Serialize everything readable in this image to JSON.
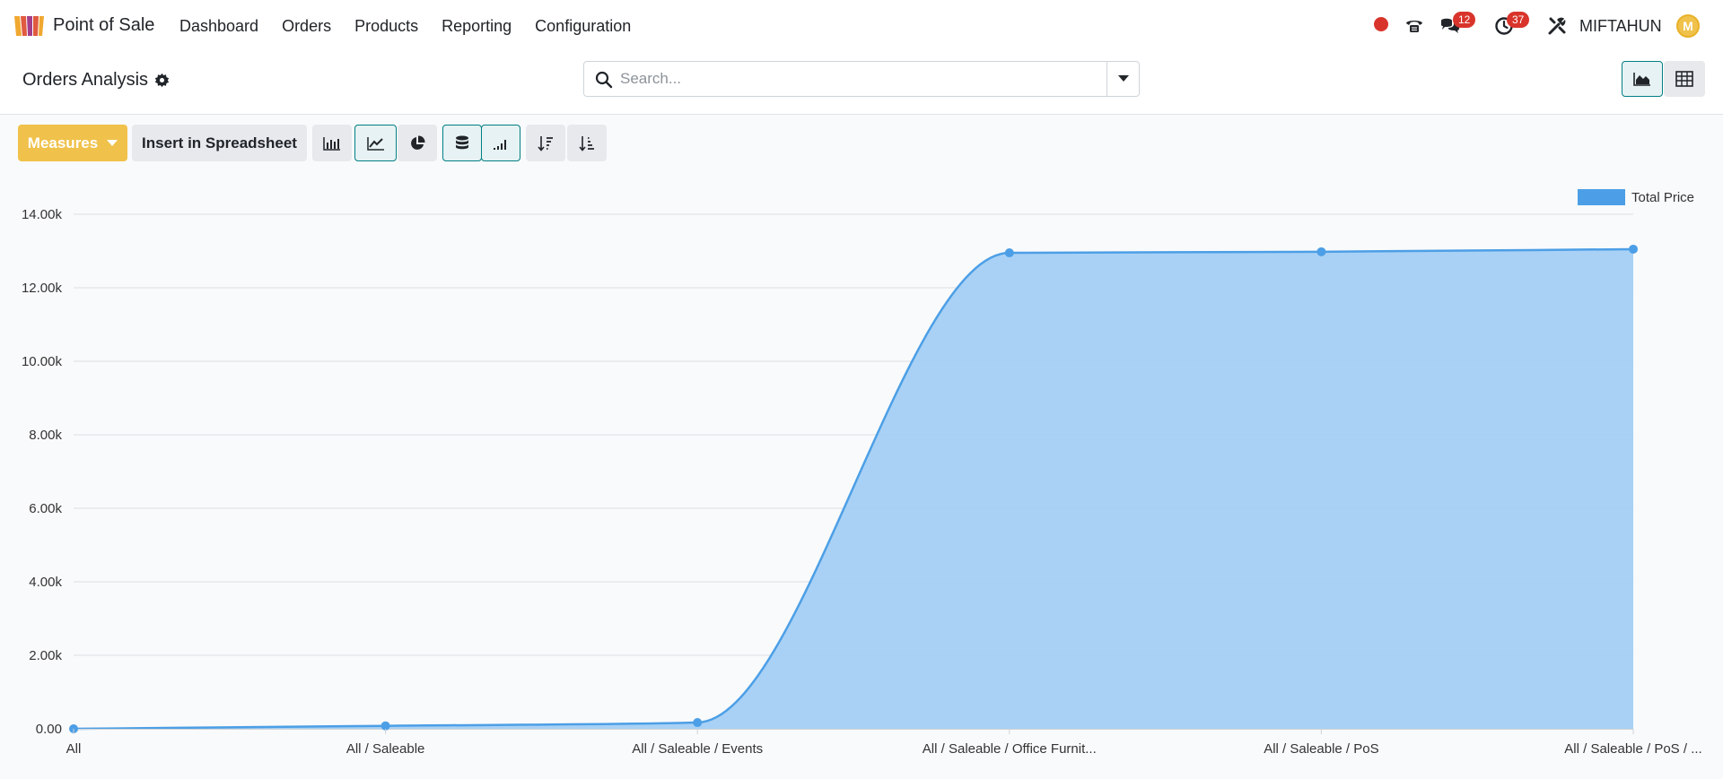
{
  "navbar": {
    "app_title": "Point of Sale",
    "menu": [
      "Dashboard",
      "Orders",
      "Products",
      "Reporting",
      "Configuration"
    ],
    "messages_count": "12",
    "activities_count": "37",
    "user_name": "MIFTAHUN",
    "avatar_letter": "M"
  },
  "control_panel": {
    "breadcrumb": "Orders Analysis",
    "search_placeholder": "Search..."
  },
  "toolbar": {
    "measures_label": "Measures",
    "insert_label": "Insert in Spreadsheet"
  },
  "colors": {
    "accent": "#017e84",
    "measures_button": "#f0c24b",
    "series_line": "#4c9fe6",
    "series_fill": "#a4cff4",
    "badge": "#d9342b"
  },
  "chart_data": {
    "type": "area",
    "categories": [
      "All",
      "All / Saleable",
      "All / Saleable / Events",
      "All / Saleable / Office Furnit...",
      "All / Saleable / PoS",
      "All / Saleable / PoS / ..."
    ],
    "series": [
      {
        "name": "Total Price",
        "values": [
          0,
          80,
          170,
          12950,
          12980,
          13050
        ]
      }
    ],
    "ylim": [
      0,
      14000
    ],
    "y_ticks": [
      "0.00",
      "2.00k",
      "4.00k",
      "6.00k",
      "8.00k",
      "10.00k",
      "12.00k",
      "14.00k"
    ],
    "grid": true,
    "legend": "top-right"
  }
}
